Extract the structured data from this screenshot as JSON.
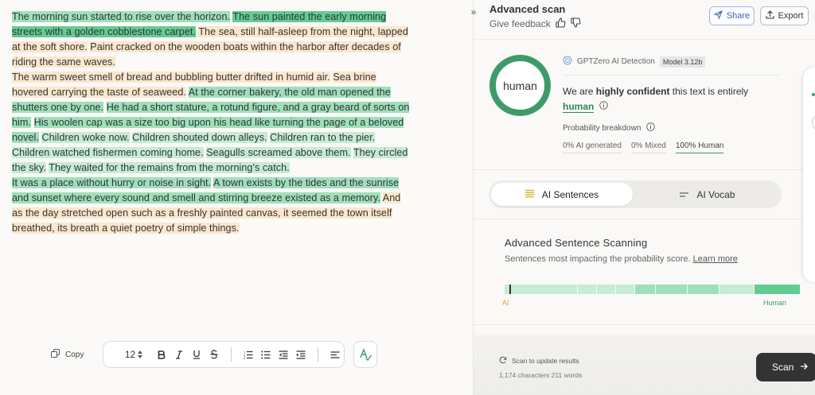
{
  "document": {
    "paragraphs": [
      [
        {
          "text": "The morning sun started to rise over the horizon.",
          "hl": "med"
        },
        {
          "text": " ",
          "hl": "none"
        },
        {
          "text": "The sun painted the early morning streets with a golden cobblestone carpet.",
          "hl": "strong"
        },
        {
          "text": " ",
          "hl": "none"
        },
        {
          "text": "The sea, still half-asleep from the night, lapped at the soft shore.",
          "hl": "orange"
        },
        {
          "text": " ",
          "hl": "none"
        },
        {
          "text": "Paint cracked on the wooden boats within the harbor after decades of riding the same waves.",
          "hl": "orange"
        }
      ],
      [
        {
          "text": "The warm sweet smell of bread and bubbling butter drifted in humid air.",
          "hl": "orange"
        },
        {
          "text": " ",
          "hl": "none"
        },
        {
          "text": "Sea brine hovered carrying the taste of seaweed.",
          "hl": "orange"
        },
        {
          "text": " ",
          "hl": "none"
        },
        {
          "text": "At the corner bakery, the old man opened the shutters one by one.",
          "hl": "med"
        },
        {
          "text": " ",
          "hl": "none"
        },
        {
          "text": "He had a short stature, a rotund figure, and a gray beard of sorts on him.",
          "hl": "med"
        },
        {
          "text": " ",
          "hl": "none"
        },
        {
          "text": "His woolen cap was a size too big upon his head like turning the page of a beloved novel.",
          "hl": "med"
        },
        {
          "text": " ",
          "hl": "none"
        },
        {
          "text": "Children woke now.",
          "hl": "light"
        },
        {
          "text": " ",
          "hl": "none"
        },
        {
          "text": "Children shouted down alleys.",
          "hl": "light"
        },
        {
          "text": " ",
          "hl": "none"
        },
        {
          "text": "Children ran to the pier.",
          "hl": "light"
        },
        {
          "text": " ",
          "hl": "none"
        },
        {
          "text": "Children watched fishermen coming home.",
          "hl": "light"
        },
        {
          "text": " ",
          "hl": "none"
        },
        {
          "text": "Seagulls screamed above them.",
          "hl": "light"
        },
        {
          "text": " ",
          "hl": "none"
        },
        {
          "text": "They circled the sky.",
          "hl": "light"
        },
        {
          "text": " ",
          "hl": "none"
        },
        {
          "text": "They waited for the remains from the morning's catch.",
          "hl": "light"
        }
      ],
      [
        {
          "text": "It was a place without hurry or noise in sight.",
          "hl": "med"
        },
        {
          "text": " ",
          "hl": "none"
        },
        {
          "text": "A town exists by the tides and the sunrise and sunset where every sound and smell and stirring breeze existed as a memory.",
          "hl": "med"
        },
        {
          "text": " ",
          "hl": "none"
        },
        {
          "text": "And as the day stretched open such as a freshly painted canvas, it seemed the town itself breathed, its breath a quiet poetry of simple things.",
          "hl": "orange"
        }
      ]
    ]
  },
  "editor_toolbar": {
    "copy_label": "Copy",
    "font_size": "12"
  },
  "panel": {
    "title": "Advanced scan",
    "feedback_label": "Give feedback",
    "share_label": "Share",
    "export_label": "Export",
    "result_label": "human",
    "detector_name": "GPTZero AI Detection",
    "model_badge": "Model 3.12b",
    "confidence_prefix": "We are ",
    "confidence_strong": "highly confident",
    "confidence_suffix": " this text is entirely",
    "confidence_result": "human",
    "probability_label": "Probability breakdown",
    "prob_ai": "0% AI generated",
    "prob_mixed": "0% Mixed",
    "prob_human": "100% Human",
    "tab_sentences": "AI Sentences",
    "tab_vocab": "AI Vocab",
    "adv_title": "Advanced Sentence Scanning",
    "adv_sub": "Sentences most impacting the probability score.",
    "learn_more": "Learn more",
    "scale_ai": "AI",
    "scale_human": "Human",
    "scan_note": "Scan to update results",
    "char_count": "1,174 characters 211 words",
    "scan_label": "Scan"
  },
  "colors": {
    "accent_green": "#3f9a6a",
    "highlight_strong": "#63cc93",
    "highlight_med": "#9fe0bb",
    "highlight_light": "#c5ecd4",
    "highlight_orange": "#fbe7cc"
  },
  "scanbar_cells": [
    {
      "shade": "light"
    },
    {
      "shade": "light"
    },
    {
      "shade": "light"
    },
    {
      "shade": "light"
    },
    {
      "shade": "med"
    },
    {
      "shade": "med"
    },
    {
      "shade": "med"
    },
    {
      "shade": "light"
    },
    {
      "shade": "strong"
    }
  ]
}
